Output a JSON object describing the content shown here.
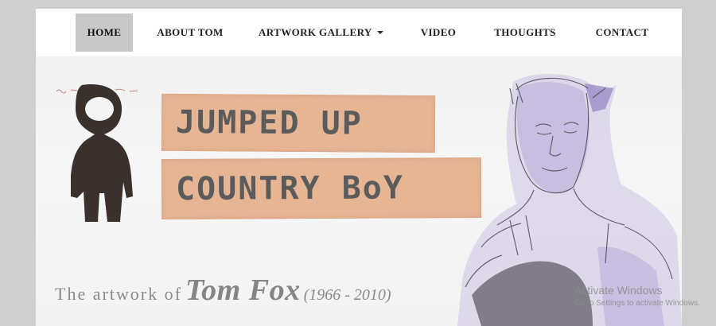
{
  "nav": {
    "items": [
      {
        "label": "HOME",
        "active": true
      },
      {
        "label": "ABOUT TOM"
      },
      {
        "label": "ARTWORK GALLERY",
        "dropdown": true
      },
      {
        "label": "VIDEO"
      },
      {
        "label": "THOUGHTS"
      },
      {
        "label": "CONTACT"
      }
    ]
  },
  "hero": {
    "title_line1": "JUMPED UP",
    "title_line2": "COUNTRY BoY",
    "tagline_lead": "The artwork of",
    "tagline_name": "Tom Fox",
    "tagline_years": "(1966 - 2010)"
  },
  "watermark": {
    "line1": "Activate Windows",
    "line2": "Go to Settings to activate Windows."
  },
  "colors": {
    "page_bg": "#cfcfcf",
    "nav_active_bg": "#c8c8c8",
    "tape": "#e6b594",
    "tape_text": "#5b5b5b",
    "figure": "#3a312d",
    "portrait_ink": "#4a4650",
    "portrait_wash": "#a99bd0"
  },
  "icons": {
    "dropdown": "caret-down-icon"
  }
}
